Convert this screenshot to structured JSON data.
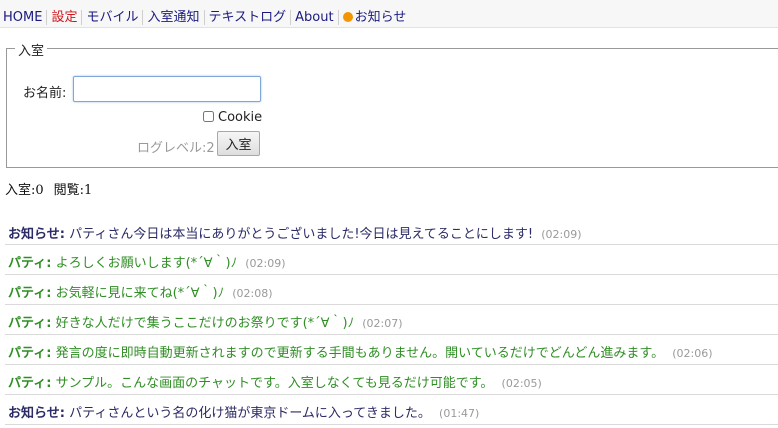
{
  "nav": {
    "items": [
      {
        "label": "HOME",
        "active": false
      },
      {
        "label": "設定",
        "active": true
      },
      {
        "label": "モバイル",
        "active": false
      },
      {
        "label": "入室通知",
        "active": false
      },
      {
        "label": "テキストログ",
        "active": false
      },
      {
        "label": "About",
        "active": false
      }
    ],
    "notice_label": "お知らせ",
    "notice_dot_color": "#f29500"
  },
  "entry": {
    "legend": "入室",
    "name_label": "お名前:",
    "name_value": "",
    "cookie_label": "Cookie",
    "cookie_checked": false,
    "loglevel_label": "ログレベル:2",
    "enter_button": "入室"
  },
  "stats": {
    "entered": "入室:0",
    "viewing": "閲覧:1"
  },
  "messages": [
    {
      "kind": "notice",
      "who": "お知らせ:",
      "text": "パティさん今日は本当にありがとうございました!今日は見えてることにします!",
      "time": "(02:09)"
    },
    {
      "kind": "party",
      "who": "パティ:",
      "text": "よろしくお願いします(*´∀｀)ﾉ",
      "time": "(02:09)"
    },
    {
      "kind": "party",
      "who": "パティ:",
      "text": "お気軽に見に来てね(*´∀｀)ﾉ",
      "time": "(02:08)"
    },
    {
      "kind": "party",
      "who": "パティ:",
      "text": "好きな人だけで集うここだけのお祭りです(*´∀｀)ﾉ",
      "time": "(02:07)"
    },
    {
      "kind": "party",
      "who": "パティ:",
      "text": "発言の度に即時自動更新されますので更新する手間もありません。開いているだけでどんどん進みます。",
      "time": "(02:06)"
    },
    {
      "kind": "party",
      "who": "パティ:",
      "text": "サンプル。こんな画面のチャットです。入室しなくても見るだけ可能です。",
      "time": "(02:05)"
    },
    {
      "kind": "notice",
      "who": "お知らせ:",
      "text": "パティさんという名の化け猫が東京ドームに入ってきました。",
      "time": "(01:47)"
    }
  ],
  "colors": {
    "notice_text": "#2b2b66",
    "party_text": "#2f8e24",
    "active_nav": "#d0161b"
  }
}
